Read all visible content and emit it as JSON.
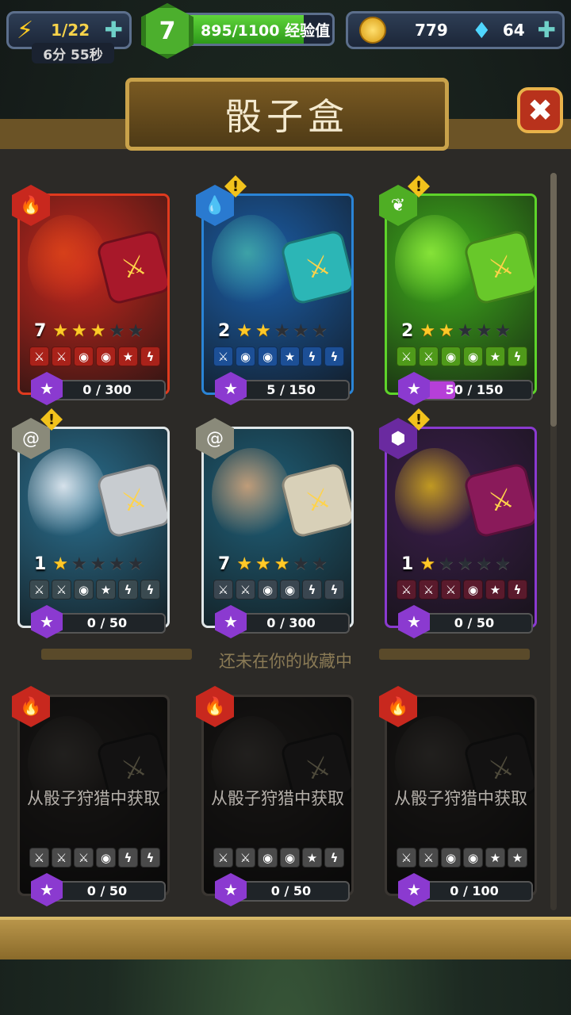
{
  "hud": {
    "energy": "1/22",
    "energy_timer": "6分 55秒",
    "level": "7",
    "xp_text": "895/1100 经验值",
    "xp_fraction": 0.81,
    "coins": "779",
    "gems": "64"
  },
  "title": "骰子盒",
  "collected_cards": [
    {
      "rank": "7",
      "stars": 3,
      "progress": "0 / 300",
      "progress_fraction": 0.0,
      "element": "fire",
      "alert": false,
      "faces": [
        "⚔",
        "⚔",
        "◉",
        "◉",
        "★",
        "ϟ"
      ],
      "color": "#c8281e",
      "face_color": "#a9221a",
      "frame": "#e03a1e",
      "die_color": "#a8182a",
      "monster_color": "#d8411a"
    },
    {
      "rank": "2",
      "stars": 2,
      "progress": "5 / 150",
      "progress_fraction": 0.03,
      "element": "water",
      "alert": true,
      "faces": [
        "⚔",
        "◉",
        "◉",
        "★",
        "ϟ",
        "ϟ"
      ],
      "color": "#1b5ea8",
      "face_color": "#1c4f96",
      "frame": "#2a84d6",
      "die_color": "#2cb6b6",
      "monster_color": "#3fa6a8"
    },
    {
      "rank": "2",
      "stars": 2,
      "progress": "50 / 150",
      "progress_fraction": 0.33,
      "element": "nature",
      "alert": true,
      "faces": [
        "⚔",
        "⚔",
        "◉",
        "◉",
        "★",
        "ϟ"
      ],
      "color": "#3fae1c",
      "face_color": "#4f9a1a",
      "frame": "#5ed42a",
      "die_color": "#68c82a",
      "monster_color": "#8ae63a"
    },
    {
      "rank": "1",
      "stars": 1,
      "progress": "0 / 50",
      "progress_fraction": 0.0,
      "element": "neutral",
      "alert": true,
      "faces": [
        "⚔",
        "⚔",
        "◉",
        "★",
        "ϟ",
        "ϟ"
      ],
      "color": "#2a6f8f",
      "face_color": "#3a4a50",
      "frame": "#e0e6e8",
      "die_color": "#c8ccd0",
      "monster_color": "#dfe8f0"
    },
    {
      "rank": "7",
      "stars": 3,
      "progress": "0 / 300",
      "progress_fraction": 0.0,
      "element": "neutral",
      "alert": false,
      "faces": [
        "⚔",
        "⚔",
        "◉",
        "◉",
        "ϟ",
        "ϟ"
      ],
      "color": "#1f5f78",
      "face_color": "#3a4650",
      "frame": "#e0e6e8",
      "die_color": "#d8d0b8",
      "monster_color": "#c8a07a"
    },
    {
      "rank": "1",
      "stars": 1,
      "progress": "0 / 50",
      "progress_fraction": 0.0,
      "element": "dark",
      "alert": true,
      "faces": [
        "⚔",
        "⚔",
        "⚔",
        "◉",
        "★",
        "ϟ"
      ],
      "color": "#3a1e4a",
      "face_color": "#5a1a2c",
      "frame": "#8a3ad0",
      "die_color": "#8a1a5a",
      "monster_color": "#c8a020"
    }
  ],
  "divider_label": "还未在你的收藏中",
  "locked_cards": [
    {
      "label": "从骰子狩猎中获取",
      "progress": "0 / 50",
      "element": "fire",
      "faces": [
        "⚔",
        "⚔",
        "⚔",
        "◉",
        "ϟ",
        "ϟ"
      ]
    },
    {
      "label": "从骰子狩猎中获取",
      "progress": "0 / 50",
      "element": "fire",
      "faces": [
        "⚔",
        "⚔",
        "◉",
        "◉",
        "★",
        "ϟ"
      ]
    },
    {
      "label": "从骰子狩猎中获取",
      "progress": "0 / 100",
      "element": "fire",
      "faces": [
        "⚔",
        "⚔",
        "◉",
        "◉",
        "★",
        "★"
      ]
    }
  ],
  "colors": {
    "fire": "#c8281e",
    "water": "#2a7ad0",
    "nature": "#4fae24",
    "neutral": "#8a8a7a",
    "dark": "#6a2aa0",
    "gem": "#8b3ad0",
    "gold": "#ffc928"
  },
  "icons": {
    "energy": "lightning-icon",
    "coin": "coin-icon",
    "gem": "diamond-icon",
    "close": "close-icon",
    "fire": "flame-icon",
    "water": "droplet-icon",
    "nature": "leaf-icon",
    "neutral": "swirl-icon",
    "dark": "dark-hex-icon"
  }
}
